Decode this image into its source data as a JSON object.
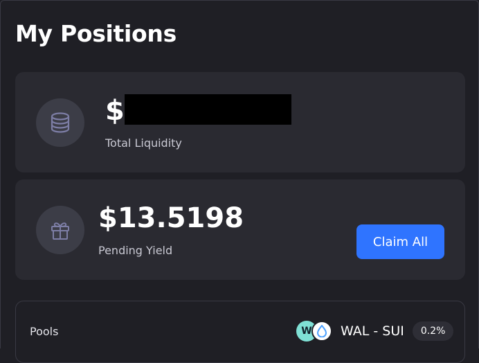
{
  "page": {
    "title": "My Positions"
  },
  "liquidity": {
    "currency_symbol": "$",
    "label": "Total Liquidity",
    "icon": "coins-stack-icon"
  },
  "yield": {
    "amount": "$13.5198",
    "label": "Pending Yield",
    "icon": "gift-icon",
    "claim_label": "Claim All"
  },
  "pools": {
    "label": "Pools",
    "pair": "WAL - SUI",
    "fee": "0.2%",
    "token_a_glyph": "W",
    "icons": [
      "wal-token-icon",
      "sui-token-icon"
    ]
  },
  "colors": {
    "background": "#1f1f25",
    "card": "#2a2a31",
    "accent": "#2f74ff",
    "icon_tint": "#7d7ea6"
  }
}
